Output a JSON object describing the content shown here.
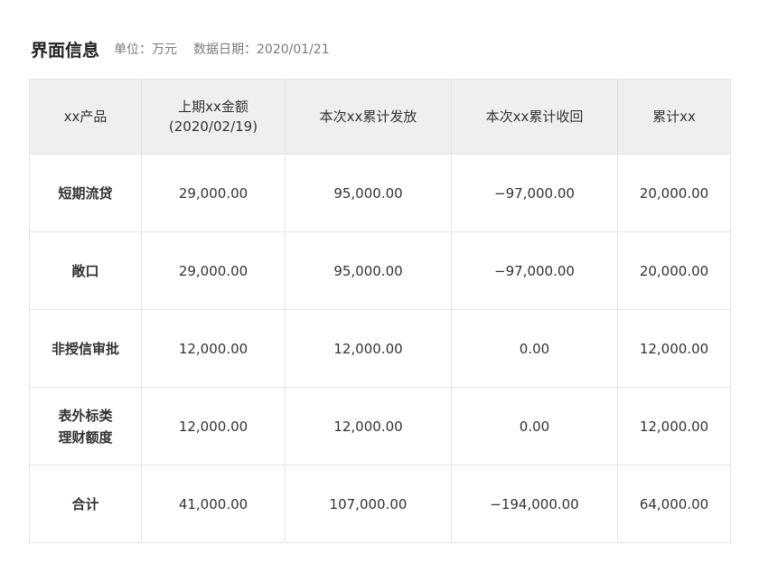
{
  "header": {
    "title": "界面信息",
    "unit": "单位：万元",
    "date": "数据日期：2020/01/21"
  },
  "table": {
    "columns": [
      {
        "lines": [
          "xx产品"
        ]
      },
      {
        "lines": [
          "上期xx金额",
          "(2020/02/19)"
        ]
      },
      {
        "lines": [
          "本次xx累计发放"
        ]
      },
      {
        "lines": [
          "本次xx累计收回"
        ]
      },
      {
        "lines": [
          "累计xx"
        ]
      }
    ],
    "rows": [
      {
        "product": [
          "短期流贷"
        ],
        "prev": "29,000.00",
        "issued": "95,000.00",
        "recovered": "−97,000.00",
        "total": "20,000.00"
      },
      {
        "product": [
          "敞口"
        ],
        "prev": "29,000.00",
        "issued": "95,000.00",
        "recovered": "−97,000.00",
        "total": "20,000.00"
      },
      {
        "product": [
          "非授信审批"
        ],
        "prev": "12,000.00",
        "issued": "12,000.00",
        "recovered": "0.00",
        "total": "12,000.00"
      },
      {
        "product": [
          "表外标类",
          "理财额度"
        ],
        "prev": "12,000.00",
        "issued": "12,000.00",
        "recovered": "0.00",
        "total": "12,000.00"
      },
      {
        "product": [
          "合计"
        ],
        "prev": "41,000.00",
        "issued": "107,000.00",
        "recovered": "−194,000.00",
        "total": "64,000.00"
      }
    ]
  }
}
